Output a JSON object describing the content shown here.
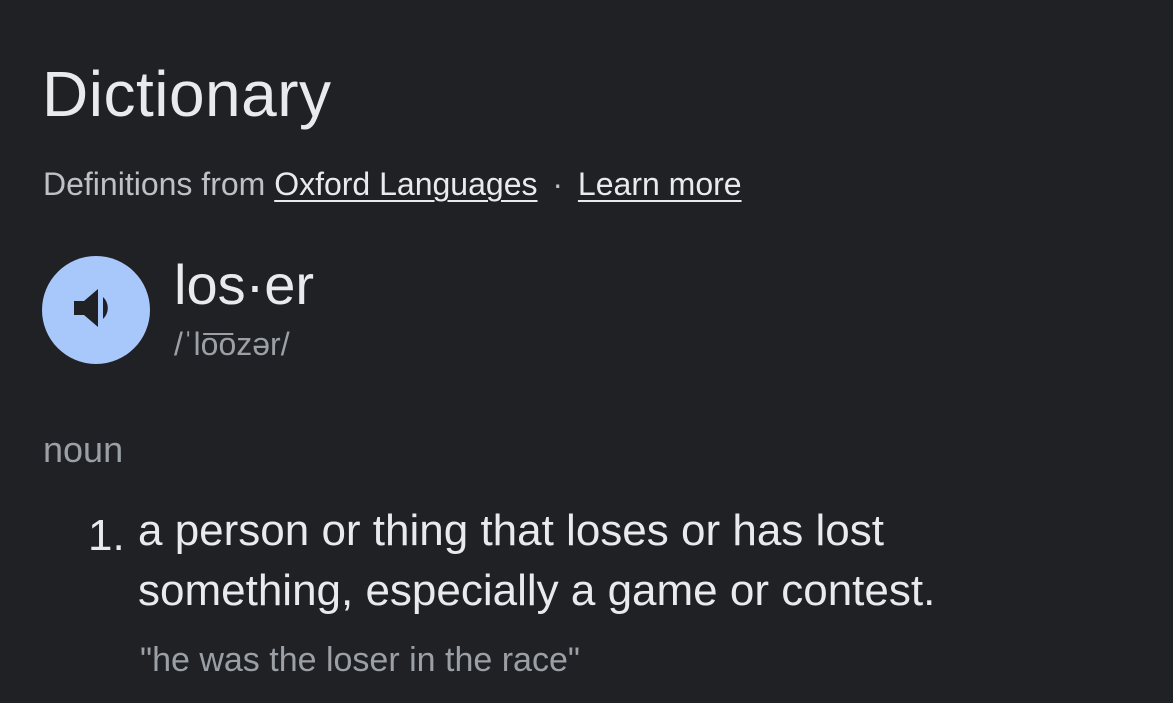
{
  "title": "Dictionary",
  "source": {
    "prefix": "Definitions from",
    "provider_link": "Oxford Languages",
    "separator": "·",
    "learn_more_link": "Learn more"
  },
  "entry": {
    "headword": "los·er",
    "pronunciation": "/ˈlo͞ozər/",
    "speaker_icon": "volume-up-icon",
    "part_of_speech": "noun",
    "senses": [
      {
        "number": "1.",
        "definition": "a person or thing that loses or has lost something, especially a game or contest.",
        "example": "\"he was the loser in the race\""
      }
    ]
  },
  "colors": {
    "background": "#202124",
    "text_primary": "#e8eaed",
    "text_secondary": "#9aa0a6",
    "speaker_button": "#a8c7fa",
    "speaker_glyph": "#202124"
  }
}
